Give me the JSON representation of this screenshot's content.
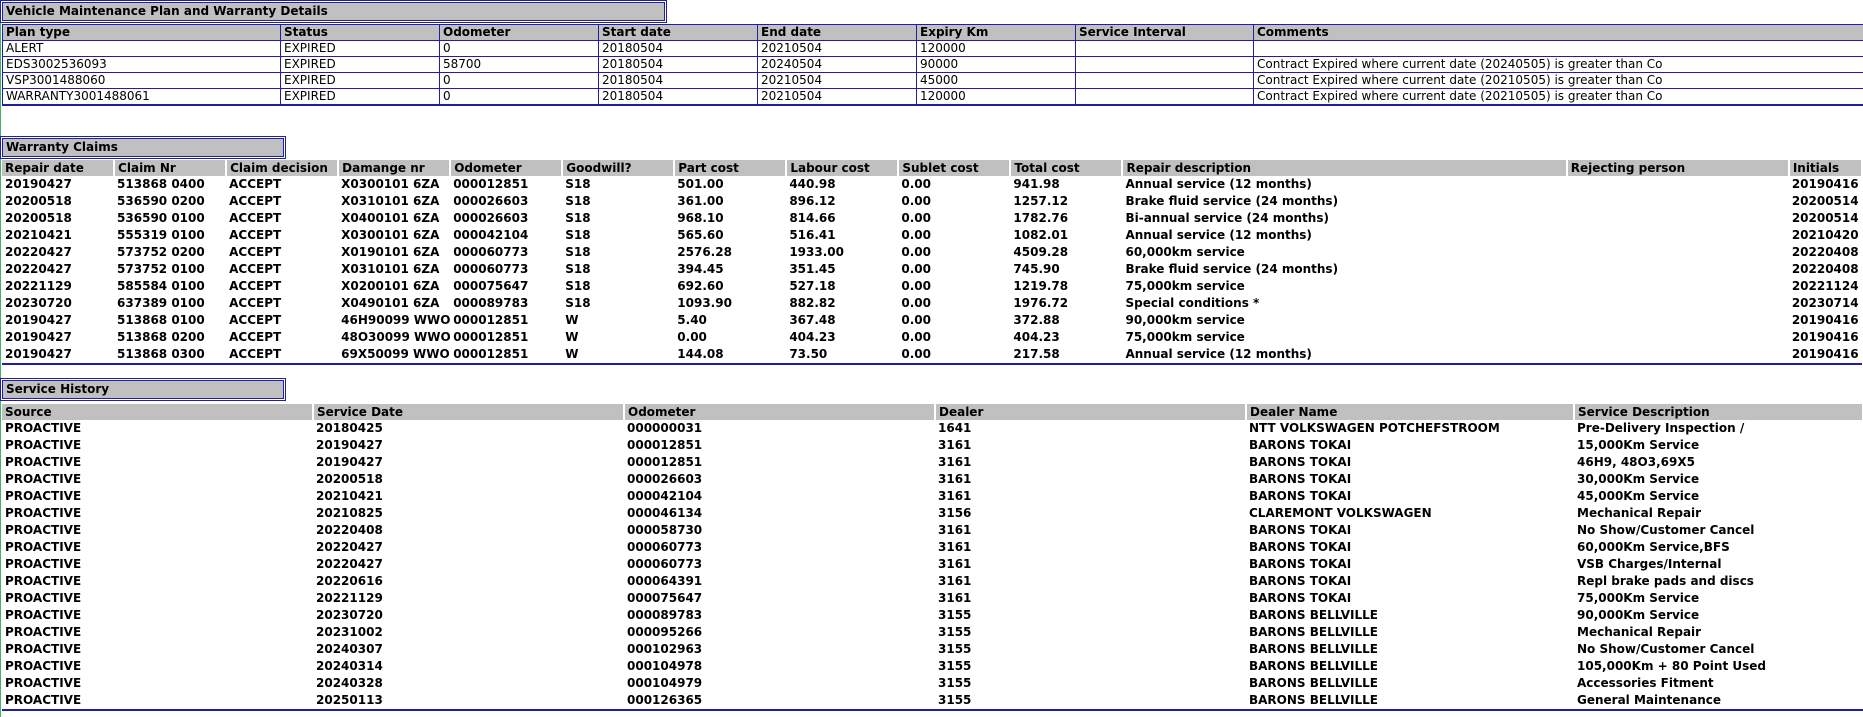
{
  "maintenance": {
    "title": "Vehicle Maintenance Plan and Warranty Details",
    "headers": [
      "Plan type",
      "Status",
      "Odometer",
      "Start date",
      "End date",
      "Expiry Km",
      "Service Interval",
      "Comments"
    ],
    "rows": [
      [
        "ALERT",
        "EXPIRED",
        "0",
        "20180504",
        "20210504",
        "120000",
        "",
        ""
      ],
      [
        "EDS3002536093",
        "EXPIRED",
        "58700",
        "20180504",
        "20240504",
        "90000",
        "",
        "Contract Expired where current date (20240505) is greater than Co"
      ],
      [
        "VSP3001488060",
        "EXPIRED",
        "0",
        "20180504",
        "20210504",
        "45000",
        "",
        "Contract Expired where current date (20210505) is greater than Co"
      ],
      [
        "WARRANTY3001488061",
        "EXPIRED",
        "0",
        "20180504",
        "20210504",
        "120000",
        "",
        "Contract Expired where current date (20210505) is greater than Co"
      ]
    ]
  },
  "claims": {
    "title": "Warranty Claims",
    "headers": [
      "Repair date",
      "Claim Nr",
      "Claim decision",
      "Damange nr",
      "Odometer",
      "Goodwill?",
      "Part cost",
      "Labour cost",
      "Sublet cost",
      "Total cost",
      "Repair description",
      "Rejecting person",
      "Initials"
    ],
    "rows": [
      [
        "20190427",
        "513868 0400",
        "ACCEPT",
        "X0300101 6ZA",
        "000012851",
        "S18",
        "501.00",
        "440.98",
        "0.00",
        "941.98",
        "Annual service (12 months)",
        "",
        "20190416"
      ],
      [
        "20200518",
        "536590 0200",
        "ACCEPT",
        "X0310101 6ZA",
        "000026603",
        "S18",
        "361.00",
        "896.12",
        "0.00",
        "1257.12",
        "Brake fluid service (24 months)",
        "",
        "20200514"
      ],
      [
        "20200518",
        "536590 0100",
        "ACCEPT",
        "X0400101 6ZA",
        "000026603",
        "S18",
        "968.10",
        "814.66",
        "0.00",
        "1782.76",
        "Bi-annual service (24 months)",
        "",
        "20200514"
      ],
      [
        "20210421",
        "555319 0100",
        "ACCEPT",
        "X0300101 6ZA",
        "000042104",
        "S18",
        "565.60",
        "516.41",
        "0.00",
        "1082.01",
        "Annual service (12 months)",
        "",
        "20210420"
      ],
      [
        "20220427",
        "573752 0200",
        "ACCEPT",
        "X0190101 6ZA",
        "000060773",
        "S18",
        "2576.28",
        "1933.00",
        "0.00",
        "4509.28",
        "60,000km service",
        "",
        "20220408"
      ],
      [
        "20220427",
        "573752 0100",
        "ACCEPT",
        "X0310101 6ZA",
        "000060773",
        "S18",
        "394.45",
        "351.45",
        "0.00",
        "745.90",
        "Brake fluid service (24 months)",
        "",
        "20220408"
      ],
      [
        "20221129",
        "585584 0100",
        "ACCEPT",
        "X0200101 6ZA",
        "000075647",
        "S18",
        "692.60",
        "527.18",
        "0.00",
        "1219.78",
        "75,000km service",
        "",
        "20221124"
      ],
      [
        "20230720",
        "637389 0100",
        "ACCEPT",
        "X0490101 6ZA",
        "000089783",
        "S18",
        "1093.90",
        "882.82",
        "0.00",
        "1976.72",
        "Special conditions *",
        "",
        "20230714"
      ],
      [
        "20190427",
        "513868 0100",
        "ACCEPT",
        "46H90099 WWO",
        "000012851",
        "W",
        "5.40",
        "367.48",
        "0.00",
        "372.88",
        "90,000km service",
        "",
        "20190416"
      ],
      [
        "20190427",
        "513868 0200",
        "ACCEPT",
        "48O30099 WWO",
        "000012851",
        "W",
        "0.00",
        "404.23",
        "0.00",
        "404.23",
        "75,000km service",
        "",
        "20190416"
      ],
      [
        "20190427",
        "513868 0300",
        "ACCEPT",
        "69X50099 WWO",
        "000012851",
        "W",
        "144.08",
        "73.50",
        "0.00",
        "217.58",
        "Annual service (12 months)",
        "",
        "20190416"
      ]
    ]
  },
  "history": {
    "title": "Service History",
    "headers": [
      "Source",
      "Service Date",
      "Odometer",
      "Dealer",
      "Dealer Name",
      "Service Description"
    ],
    "rows": [
      [
        "PROACTIVE",
        "20180425",
        "000000031",
        "1641",
        "NTT VOLKSWAGEN POTCHEFSTROOM",
        "Pre-Delivery Inspection /"
      ],
      [
        "PROACTIVE",
        "20190427",
        "000012851",
        "3161",
        "BARONS TOKAI",
        "15,000Km Service"
      ],
      [
        "PROACTIVE",
        "20190427",
        "000012851",
        "3161",
        "BARONS TOKAI",
        "46H9, 48O3,69X5"
      ],
      [
        "PROACTIVE",
        "20200518",
        "000026603",
        "3161",
        "BARONS TOKAI",
        "30,000Km Service"
      ],
      [
        "PROACTIVE",
        "20210421",
        "000042104",
        "3161",
        "BARONS TOKAI",
        "45,000Km Service"
      ],
      [
        "PROACTIVE",
        "20210825",
        "000046134",
        "3156",
        "CLAREMONT VOLKSWAGEN",
        "Mechanical Repair"
      ],
      [
        "PROACTIVE",
        "20220408",
        "000058730",
        "3161",
        "BARONS TOKAI",
        "No Show/Customer Cancel"
      ],
      [
        "PROACTIVE",
        "20220427",
        "000060773",
        "3161",
        "BARONS TOKAI",
        "60,000Km Service,BFS"
      ],
      [
        "PROACTIVE",
        "20220427",
        "000060773",
        "3161",
        "BARONS TOKAI",
        "VSB Charges/Internal"
      ],
      [
        "PROACTIVE",
        "20220616",
        "000064391",
        "3161",
        "BARONS TOKAI",
        "Repl brake pads and discs"
      ],
      [
        "PROACTIVE",
        "20221129",
        "000075647",
        "3161",
        "BARONS TOKAI",
        "75,000Km Service"
      ],
      [
        "PROACTIVE",
        "20230720",
        "000089783",
        "3155",
        "BARONS BELLVILLE",
        "90,000Km Service"
      ],
      [
        "PROACTIVE",
        "20231002",
        "000095266",
        "3155",
        "BARONS BELLVILLE",
        "Mechanical Repair"
      ],
      [
        "PROACTIVE",
        "20240307",
        "000102963",
        "3155",
        "BARONS BELLVILLE",
        "No Show/Customer Cancel"
      ],
      [
        "PROACTIVE",
        "20240314",
        "000104978",
        "3155",
        "BARONS BELLVILLE",
        "105,000Km + 80 Point Used"
      ],
      [
        "PROACTIVE",
        "20240328",
        "000104979",
        "3155",
        "BARONS BELLVILLE",
        "Accessories Fitment"
      ],
      [
        "PROACTIVE",
        "20250113",
        "000126365",
        "3155",
        "BARONS BELLVILLE",
        "General Maintenance"
      ]
    ]
  }
}
